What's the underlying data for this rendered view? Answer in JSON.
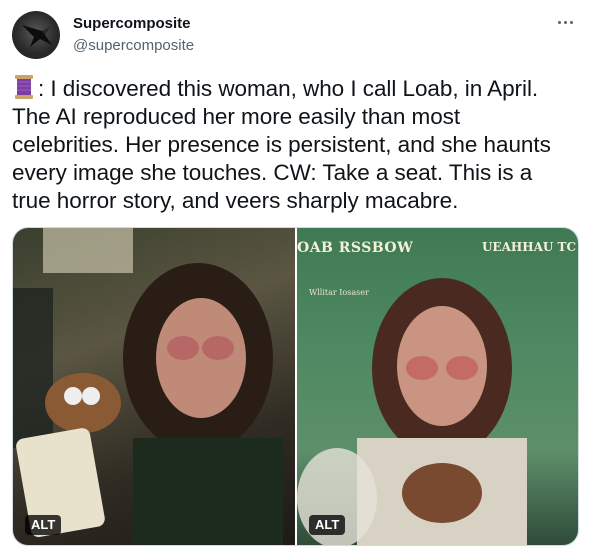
{
  "tweet": {
    "author": {
      "display_name": "Supercomposite",
      "handle": "@supercomposite"
    },
    "more_icon": "more-horizontal-icon",
    "emoji": "thread-spool-emoji",
    "text_lines": [
      ": I discovered this woman, who I call Loab, in April.",
      "The AI reproduced her more easily than most",
      "celebrities. Her presence is persistent, and she haunts",
      "every image she touches. CW: Take a seat. This is a",
      "true horror story, and veers sharply macabre."
    ]
  },
  "media": {
    "images": [
      {
        "alt_label": "ALT"
      },
      {
        "alt_label": "ALT",
        "overlay_title": "OAB RSSBOW",
        "overlay_title_right": "UEAHHAU TC",
        "overlay_small": "Wllitar Iosaser"
      }
    ]
  },
  "colors": {
    "text": "#0f1419",
    "secondary": "#536471",
    "border": "#cfd9de"
  }
}
